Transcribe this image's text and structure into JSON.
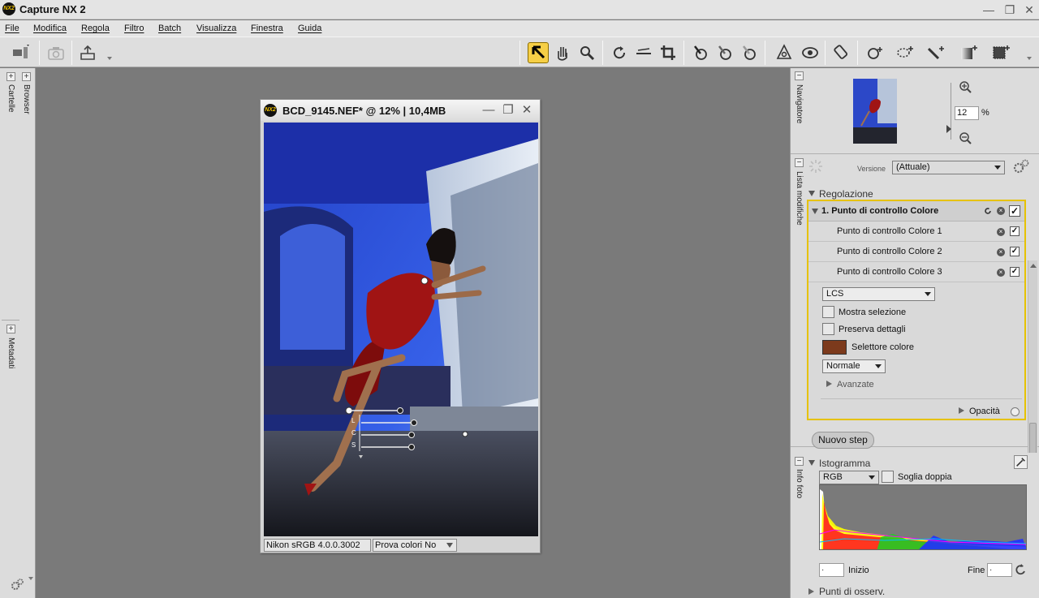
{
  "app": {
    "title": "Capture NX 2",
    "logo_text": "NX2"
  },
  "window_controls": {
    "minimize": "—",
    "restore": "❐",
    "close": "✕"
  },
  "menu": [
    "File",
    "Modifica",
    "Regola",
    "Filtro",
    "Batch",
    "Visualizza",
    "Finestra",
    "Guida"
  ],
  "toolbar": {
    "tools": [
      "direct-select-tool-icon",
      "hand-tool-icon",
      "zoom-tool-icon",
      "rotate-tool-icon",
      "straighten-tool-icon",
      "crop-tool-icon",
      "black-control-point-icon",
      "white-control-point-icon",
      "neutral-control-point-icon",
      "red-eye-control-point-icon",
      "red-eye-tool-icon",
      "auto-retouch-brush-icon",
      "color-control-point-icon",
      "lasso-selection-icon",
      "selection-brush-icon",
      "gradient-selection-icon",
      "fill-remove-icon"
    ],
    "active_tool": "direct-select-tool-icon"
  },
  "left_panel": {
    "tabs": [
      "Cartelle",
      "Browser",
      "Metadati"
    ]
  },
  "image_window": {
    "title": "BCD_9145.NEF* @ 12% | 10,4MB",
    "color_profile": "Nikon sRGB 4.0.0.3002",
    "soft_proof": "Prova colori No",
    "control_point_labels": [
      "L",
      "C",
      "S"
    ]
  },
  "navigator": {
    "tab": "Navigatore",
    "zoom_value": "12",
    "zoom_unit": "%"
  },
  "edit_list": {
    "tab": "Lista modifiche",
    "version_label": "Versione",
    "version_value": "(Attuale)",
    "section": "Regolazione",
    "step_title": "1. Punto di controllo Colore",
    "sub_items": [
      "Punto di controllo Colore 1",
      "Punto di controllo Colore 2",
      "Punto di controllo Colore 3"
    ],
    "mode": "LCS",
    "show_selection": "Mostra selezione",
    "preserve_details": "Preserva dettagli",
    "color_picker": "Selettore colore",
    "color_picker_value": "#7c3a1c",
    "blend_mode": "Normale",
    "advanced": "Avanzate",
    "opacity": "Opacità",
    "new_step": "Nuovo step"
  },
  "photo_info": {
    "tab": "Info foto",
    "histogram": "Istogramma",
    "channel": "RGB",
    "double_threshold": "Soglia doppia",
    "start_label": "Inizio",
    "start_value": "·",
    "end_label": "Fine",
    "end_value": "·",
    "watch_points": "Punti di osserv."
  }
}
